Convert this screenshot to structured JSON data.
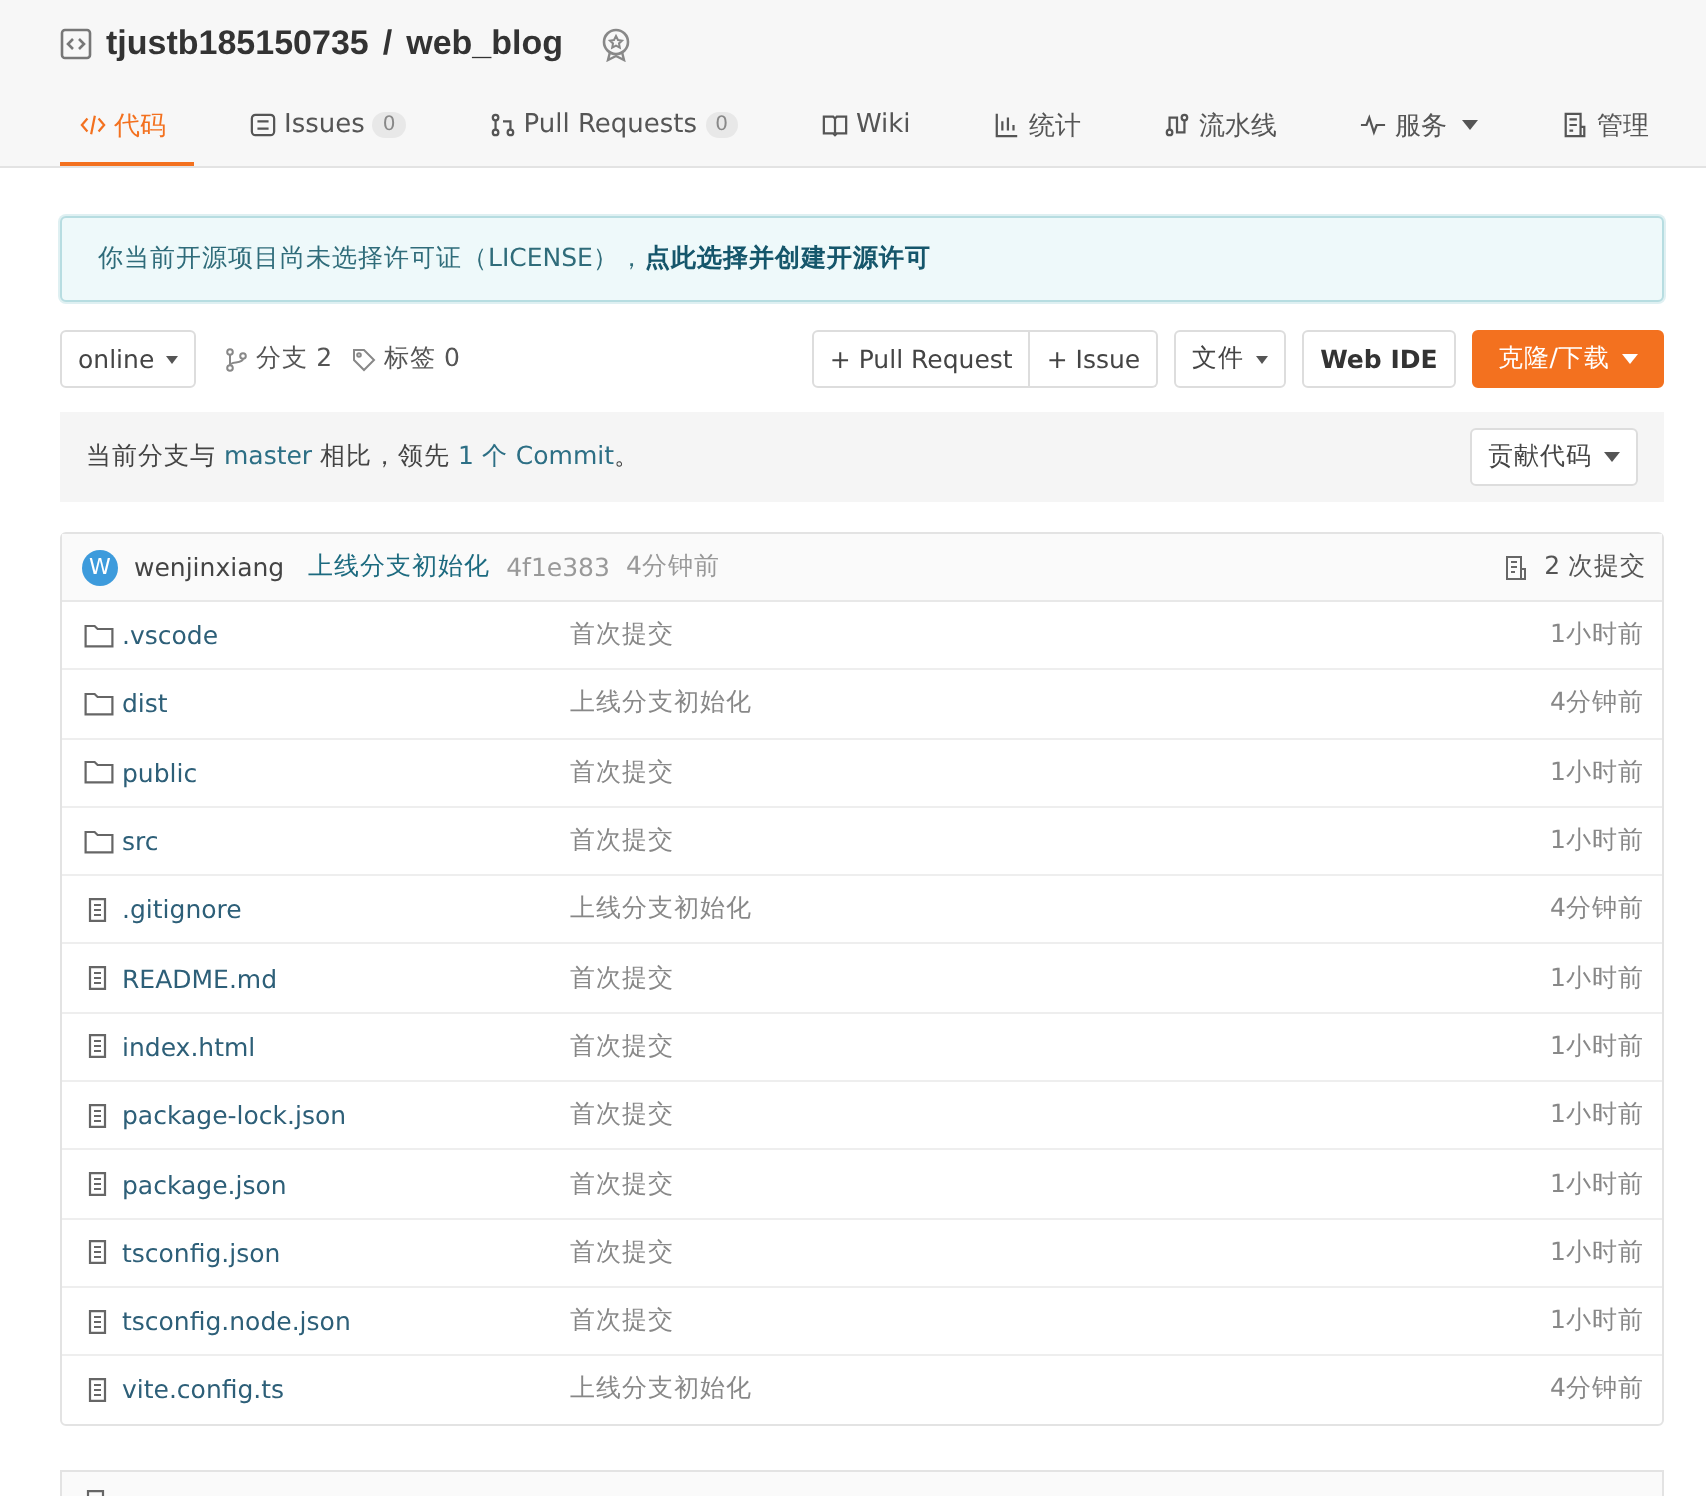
{
  "repo": {
    "owner": "tjustb185150735",
    "separator": "/",
    "name": "web_blog"
  },
  "tabs": [
    {
      "label": "代码",
      "selected": true
    },
    {
      "label": "Issues",
      "count": "0",
      "selected": false
    },
    {
      "label": "Pull Requests",
      "count": "0",
      "selected": false
    },
    {
      "label": "Wiki",
      "selected": false
    },
    {
      "label": "统计",
      "selected": false
    },
    {
      "label": "流水线",
      "selected": false
    },
    {
      "label": "服务",
      "dropdown": true,
      "selected": false
    },
    {
      "label": "管理",
      "selected": false
    }
  ],
  "license_notice": {
    "text": "你当前开源项目尚未选择许可证（LICENSE），",
    "link": "点此选择并创建开源许可"
  },
  "toolbar": {
    "branch": "online",
    "branches": "分支 2",
    "tags": "标签 0",
    "pull_request": "+ Pull Request",
    "issue": "+ Issue",
    "file_menu": "文件",
    "web_ide": "Web IDE",
    "clone": "克隆/下载"
  },
  "compare": {
    "parts": [
      "当前分支与 ",
      "master",
      " 相比，领先 ",
      "1 个 Commit",
      "。"
    ],
    "contribute": "贡献代码"
  },
  "latest_commit": {
    "avatar": "W",
    "author": "wenjinxiang",
    "message": "上线分支初始化",
    "hash": "4f1e383",
    "time": "4分钟前",
    "commits": "2 次提交"
  },
  "files": [
    {
      "kind": "folder",
      "name": ".vscode",
      "message": "首次提交",
      "time": "1小时前"
    },
    {
      "kind": "folder",
      "name": "dist",
      "message": "上线分支初始化",
      "time": "4分钟前"
    },
    {
      "kind": "folder",
      "name": "public",
      "message": "首次提交",
      "time": "1小时前"
    },
    {
      "kind": "folder",
      "name": "src",
      "message": "首次提交",
      "time": "1小时前"
    },
    {
      "kind": "file",
      "name": ".gitignore",
      "message": "上线分支初始化",
      "time": "4分钟前"
    },
    {
      "kind": "file",
      "name": "README.md",
      "message": "首次提交",
      "time": "1小时前"
    },
    {
      "kind": "file",
      "name": "index.html",
      "message": "首次提交",
      "time": "1小时前"
    },
    {
      "kind": "file",
      "name": "package-lock.json",
      "message": "首次提交",
      "time": "1小时前"
    },
    {
      "kind": "file",
      "name": "package.json",
      "message": "首次提交",
      "time": "1小时前"
    },
    {
      "kind": "file",
      "name": "tsconfig.json",
      "message": "首次提交",
      "time": "1小时前"
    },
    {
      "kind": "file",
      "name": "tsconfig.node.json",
      "message": "首次提交",
      "time": "1小时前"
    },
    {
      "kind": "file",
      "name": "vite.config.ts",
      "message": "上线分支初始化",
      "time": "4分钟前"
    }
  ]
}
